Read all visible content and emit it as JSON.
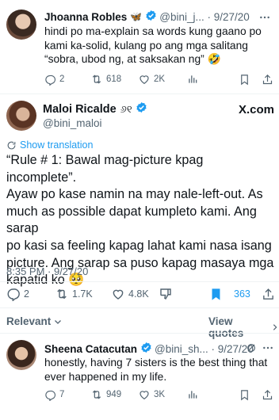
{
  "colors": {
    "text": "#0f1419",
    "muted": "#536471",
    "accent": "#1d9bf0",
    "verified": "#1d9bf0",
    "divider": "#eff3f4",
    "bookmark_active": "#1d9bf0"
  },
  "reply_top": {
    "name": "Jhoanna Robles",
    "name_emoji": "🦋",
    "handle_date": "@bini_j... · 9/27/20",
    "text_lines": [
      "hindi po ma-explain sa words kung gaano po",
      "kami ka-solid, kulang po ang mga salitang",
      "“sobra, ubod ng, at saksakan ng” 🤣"
    ],
    "replies": "2",
    "reposts": "618",
    "likes": "2K"
  },
  "main_tweet": {
    "name": "Maloi Ricalde",
    "name_symbol": "୬୧",
    "handle": "@bini_maloi",
    "watermark": "X.com",
    "translate_label": "Show translation",
    "text_lines": [
      "“Rule # 1: Bawal mag-picture kpag incomplete”.",
      "Ayaw po kase namin na may nale-left-out. As",
      "much as possible dapat kumpleto kami. Ang sarap",
      "po kasi sa feeling kapag lahat kami nasa isang",
      "picture. Ang sarap sa puso kapag masaya mga",
      "kapatid ko 🥺"
    ],
    "timestamp": "8:35 PM · 9/27/20",
    "replies": "2",
    "reposts": "1.7K",
    "likes": "4.8K",
    "bookmarks": "363"
  },
  "sort_bar": {
    "relevant_label": "Relevant",
    "view_quotes_label": "View quotes"
  },
  "reply_bottom": {
    "name": "Sheena Catacutan",
    "handle_date": "@bini_sh... · 9/27/20",
    "text_lines": [
      "honestly, having 7 sisters is the best thing that",
      "ever happened in my life."
    ],
    "replies": "7",
    "reposts": "949",
    "likes": "3K"
  },
  "icons": [
    "more-icon",
    "reply-icon",
    "repost-icon",
    "like-icon",
    "views-icon",
    "bookmark-icon",
    "share-icon",
    "dislike-icon",
    "translate-icon",
    "verified-icon",
    "chevron-down-icon",
    "chevron-right-icon",
    "grok-icon"
  ]
}
